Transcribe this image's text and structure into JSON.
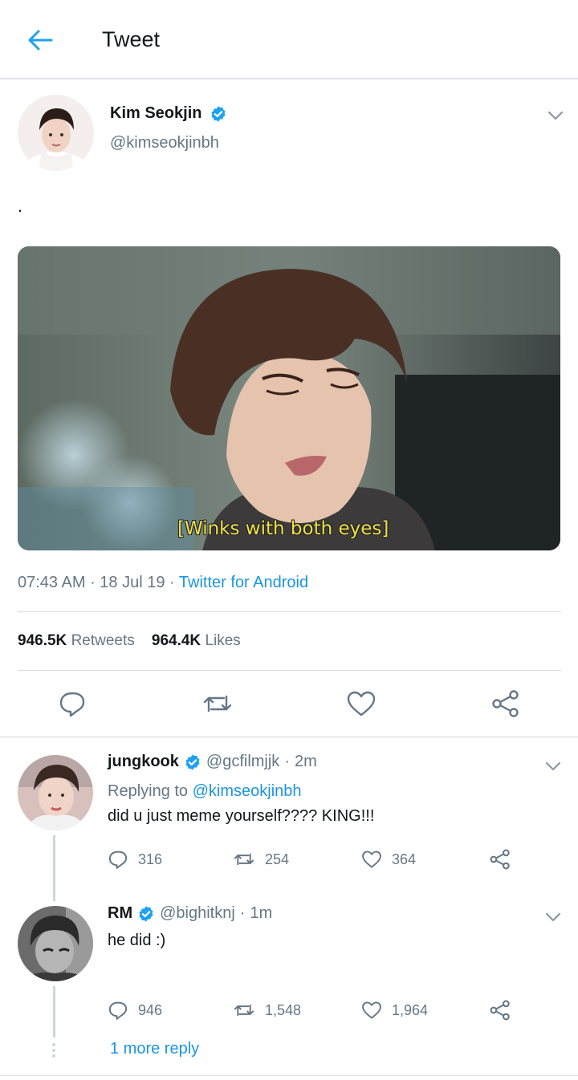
{
  "header": {
    "title": "Tweet"
  },
  "tweet": {
    "author_name": "Kim Seokjin",
    "author_handle": "@kimseokjinbh",
    "text": ".",
    "image_caption": "[Winks with both eyes]",
    "time": "07:43 AM",
    "date": "18 Jul 19",
    "source": "Twitter for Android",
    "retweets": "946.5K",
    "retweets_label": "Retweets",
    "likes": "964.4K",
    "likes_label": "Likes"
  },
  "replies": [
    {
      "name": "jungkook",
      "handle": "@gcfilmjjk",
      "time": "2m",
      "replying_prefix": "Replying to",
      "replying_to": "@kimseokjinbh",
      "text": "did u just meme yourself???? KING!!!",
      "reply_count": "316",
      "retweet_count": "254",
      "like_count": "364"
    },
    {
      "name": "RM",
      "handle": "@bighitknj",
      "time": "1m",
      "text": "he did :)",
      "reply_count": "946",
      "retweet_count": "1,548",
      "like_count": "1,964"
    }
  ],
  "more_replies": "1 more reply",
  "colors": {
    "accent": "#1b95e0",
    "verified": "#1da1f2",
    "muted": "#657786"
  }
}
